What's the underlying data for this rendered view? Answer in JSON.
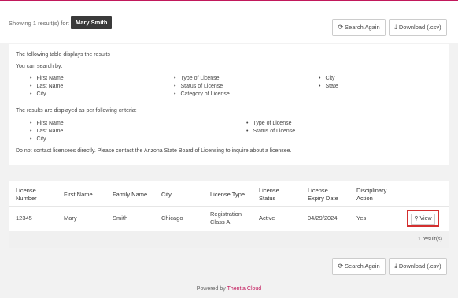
{
  "header": {
    "showing_label": "Showing 1 result(s) for:",
    "query": "Mary Smith",
    "search_again": "Search Again",
    "download": "Download (.csv)"
  },
  "info": {
    "intro": "The following table displays the results",
    "search_by_label": "You can search by:",
    "search_by": {
      "col1": [
        "First Name",
        "Last Name",
        "City"
      ],
      "col2": [
        "Type of License",
        "Status of License",
        "Category of License"
      ],
      "col3": [
        "City",
        "State"
      ]
    },
    "criteria_label": "The results are displayed as per following criteria:",
    "criteria": {
      "col1": [
        "First Name",
        "Last Name",
        "City"
      ],
      "col2": [
        "Type of License",
        "Status of License"
      ]
    },
    "notice": "Do not contact licensees directly. Please contact the Arizona State Board of Licensing to inquire about a licensee."
  },
  "table": {
    "headers": {
      "license_number": [
        "License",
        "Number"
      ],
      "first_name": "First Name",
      "family_name": "Family Name",
      "city": "City",
      "license_type": "License Type",
      "license_status": [
        "License",
        "Status"
      ],
      "expiry": [
        "License",
        "Expiry Date"
      ],
      "disciplinary": [
        "Disciplinary",
        "Action"
      ]
    },
    "rows": [
      {
        "license_number": "12345",
        "first_name": "Mary",
        "family_name": "Smith",
        "city": "Chicago",
        "license_type": [
          "Registration",
          "Class A"
        ],
        "status": "Active",
        "expiry": "04/29/2024",
        "disciplinary": "Yes",
        "action_label": "View"
      }
    ],
    "results_count": "1 result(s)"
  },
  "bottom": {
    "search_again": "Search Again",
    "download": "Download (.csv)"
  },
  "footer": {
    "powered_by": "Powered by",
    "brand": "Thentia Cloud"
  },
  "colors": {
    "accent": "#c2185b",
    "highlight": "#d32f2f"
  }
}
